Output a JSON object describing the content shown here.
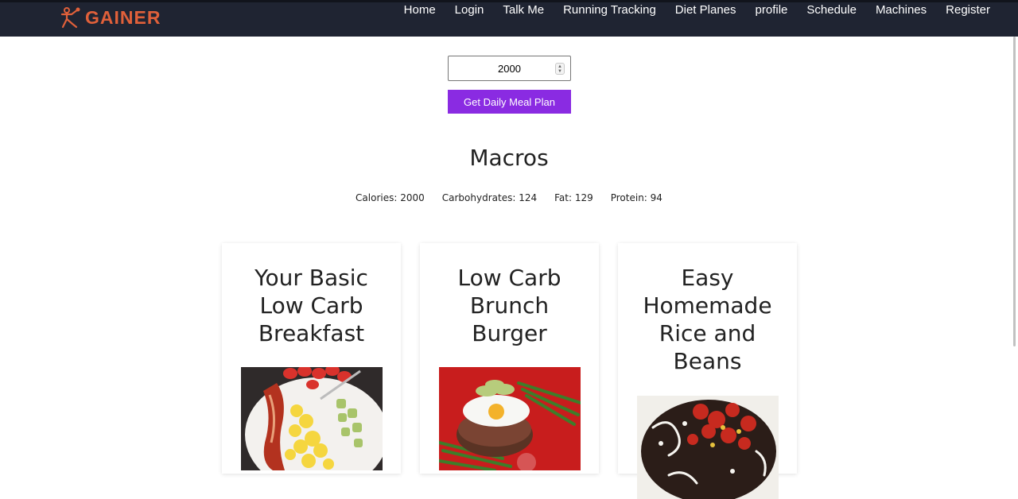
{
  "brand": {
    "name": "GAINER"
  },
  "nav": {
    "items": [
      "Home",
      "Login",
      "Talk Me",
      "Running Tracking",
      "Diet Planes",
      "profile",
      "Schedule",
      "Machines",
      "Register"
    ]
  },
  "form": {
    "calories_value": "2000",
    "submit_label": "Get Daily Meal Plan"
  },
  "macros": {
    "title": "Macros",
    "calories": "Calories: 2000",
    "carbohydrates": "Carbohydrates: 124",
    "fat": "Fat: 129",
    "protein": "Protein: 94"
  },
  "meals": [
    {
      "title": "Your Basic Low Carb Breakfast",
      "image": "bacon-eggs-avocado-plate"
    },
    {
      "title": "Low Carb Brunch Burger",
      "image": "burger-patty-fried-egg-asparagus"
    },
    {
      "title": "Easy Homemade Rice and Beans",
      "image": "rice-beans-salsa-bowl"
    }
  ],
  "colors": {
    "topbar": "#1f2432",
    "brand": "#e0603a",
    "button": "#8a2be2"
  }
}
